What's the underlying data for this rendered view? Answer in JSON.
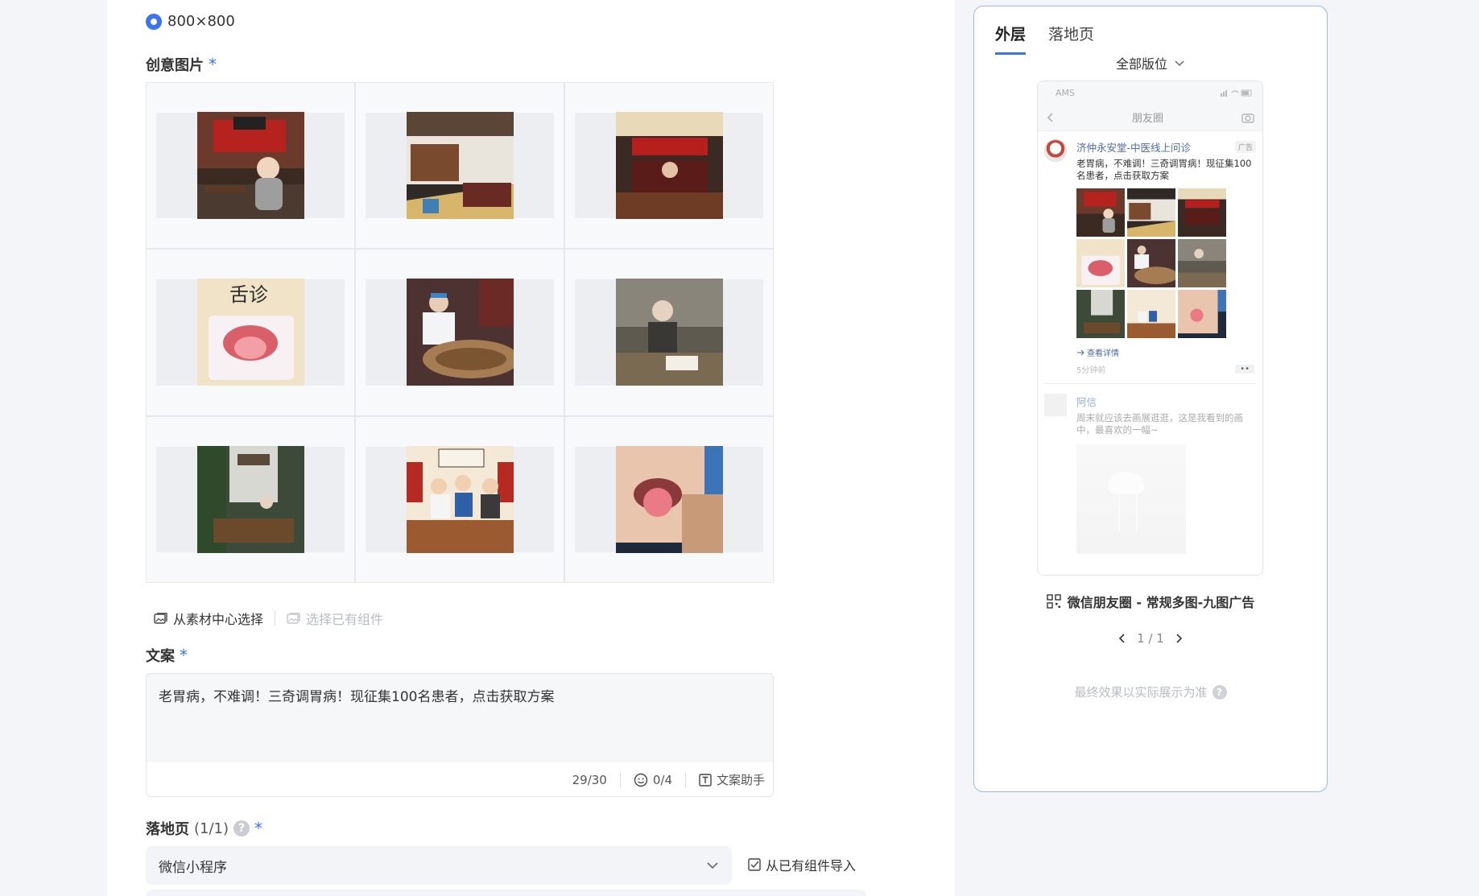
{
  "size_option": "800×800",
  "creative_images": {
    "label": "创意图片",
    "required_mark": "*",
    "images": [
      {
        "icon": "tcm-cartoon-doctor"
      },
      {
        "icon": "pharmacy-interior"
      },
      {
        "icon": "clinic-hall-doctor"
      },
      {
        "icon": "tongue-diagnosis-chart"
      },
      {
        "icon": "herbs-sorting-masked"
      },
      {
        "icon": "elder-writing-prescription"
      },
      {
        "icon": "courtyard-herbalist"
      },
      {
        "icon": "cartoon-consultation"
      },
      {
        "icon": "tongue-video-call"
      }
    ],
    "actions": {
      "from_material": "从素材中心选择",
      "from_component": "选择已有组件"
    }
  },
  "copy": {
    "label": "文案",
    "required_mark": "*",
    "text": "老胃病，不难调！三奇调胃病！现征集100名患者，点击获取方案",
    "char_count": "29/30",
    "emoji_count": "0/4",
    "assistant": "文案助手"
  },
  "landing": {
    "label": "落地页",
    "count": "(1/1)",
    "help": "?",
    "required_mark": "*",
    "select_value": "微信小程序",
    "import_link": "从已有组件导入"
  },
  "preview": {
    "tabs": [
      "外层",
      "落地页"
    ],
    "active_tab": 0,
    "placement": "全部版位",
    "phone": {
      "carrier": "AMS",
      "nav_title": "朋友圈",
      "advertiser": "济仲永安堂-中医线上问诊",
      "ad_tag": "广告",
      "ad_text": "老胃病，不难调！三奇调胃病！现征集100名患者，点击获取方案",
      "detail_link": "查看详情",
      "time": "5分钟前",
      "more": "••",
      "friend_name": "阿信",
      "friend_text": "周末就应该去画展逛逛，这是我看到的画中，最喜欢的一幅~"
    },
    "title": "微信朋友圈 - 常规多图-九图广告",
    "pager": "1 / 1",
    "footnote": "最终效果以实际展示为准",
    "help": "?"
  },
  "colors": {
    "accent": "#3a74f3",
    "link": "#4c6aa5"
  }
}
